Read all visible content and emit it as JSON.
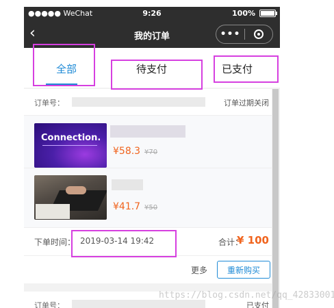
{
  "statusbar": {
    "carrier": "●●●●● WeChat",
    "time": "9:26",
    "battery": "100%"
  },
  "navbar": {
    "back": "‹",
    "title": "我的订单",
    "more": "•••"
  },
  "tabs": [
    {
      "label": "全部",
      "active": true
    },
    {
      "label": "待支付",
      "active": false
    },
    {
      "label": "已支付",
      "active": false
    }
  ],
  "orders": [
    {
      "order_no_label": "订单号：",
      "status": "订单过期关闭",
      "items": [
        {
          "thumb_text": "Connection.",
          "price": "¥58.3",
          "original_price": "¥70"
        },
        {
          "price": "¥41.7",
          "original_price": "¥50"
        }
      ],
      "time_label": "下单时间：",
      "time_value": "2019-03-14 19:42",
      "total_label": "合计：",
      "total_amount": "¥ 100",
      "more": "更多",
      "rebuy": "重新购买"
    },
    {
      "order_no_label": "订单号：",
      "status": "已支付"
    }
  ],
  "watermark": "https://blog.csdn.net/qq_42833001",
  "colors": {
    "accent": "#1e8ad6",
    "price": "#f0641e",
    "highlight": "#d63fe0",
    "bar": "#2e2e2e"
  }
}
